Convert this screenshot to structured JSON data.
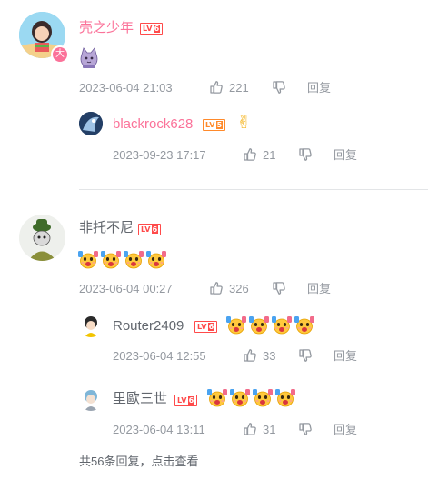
{
  "comments": [
    {
      "user": "壳之少年",
      "level_prefix": "LV",
      "level_num": "6",
      "badge": "大",
      "date": "2023-06-04 21:03",
      "likes": "221",
      "reply_label": "回复",
      "sticker": "cat-sticker",
      "replies": [
        {
          "user": "blackrock628",
          "level_prefix": "LV",
          "level_num": "5",
          "emoji": "✌",
          "date": "2023-09-23 17:17",
          "likes": "21",
          "reply_label": "回复"
        }
      ]
    },
    {
      "user": "非托不尼",
      "level_prefix": "LV",
      "level_num": "6",
      "date": "2023-06-04 00:27",
      "likes": "326",
      "reply_label": "回复",
      "emotes": [
        "cheer-face-emote",
        "cheer-face-emote",
        "cheer-face-emote",
        "cheer-face-emote"
      ],
      "replies": [
        {
          "user": "Router2409",
          "level_prefix": "LV",
          "level_num": "6",
          "date": "2023-06-04 12:55",
          "likes": "33",
          "reply_label": "回复",
          "emotes": [
            "cheer-face-emote",
            "cheer-face-emote",
            "cheer-face-emote",
            "cheer-face-emote"
          ]
        },
        {
          "user": "里歐三世",
          "level_prefix": "LV",
          "level_num": "6",
          "date": "2023-06-04 13:11",
          "likes": "31",
          "reply_label": "回复",
          "emotes": [
            "cheer-face-emote",
            "cheer-face-emote",
            "cheer-face-emote",
            "cheer-face-emote"
          ]
        }
      ],
      "more_replies": "共56条回复，点击查看"
    }
  ],
  "colors": {
    "username_vip": "#fb7299",
    "username": "#61666d",
    "meta": "#9499a0",
    "level6": "#ff4a4a",
    "level5": "#ff8a2b",
    "divider": "#e3e5e7"
  }
}
